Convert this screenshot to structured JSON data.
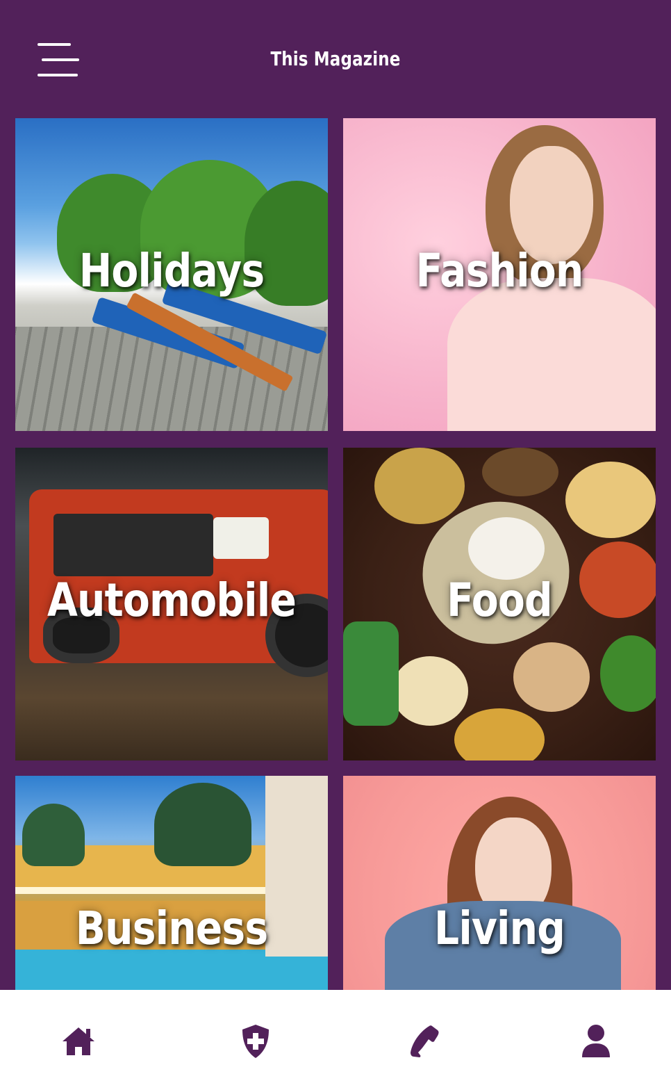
{
  "header": {
    "title": "This Magazine",
    "menu_icon": "hamburger-menu-icon"
  },
  "categories": [
    {
      "label": "Holidays",
      "image": "beach-lounge-chairs"
    },
    {
      "label": "Fashion",
      "image": "woman-pink-background"
    },
    {
      "label": "Automobile",
      "image": "red-ford-truck"
    },
    {
      "label": "Food",
      "image": "table-of-dishes"
    },
    {
      "label": "Business",
      "image": "resort-hotel-pool"
    },
    {
      "label": "Living",
      "image": "woman-denim-jacket"
    }
  ],
  "bottom_nav": {
    "items": [
      {
        "icon": "home-icon"
      },
      {
        "icon": "shield-plus-icon"
      },
      {
        "icon": "phone-icon"
      },
      {
        "icon": "user-icon"
      }
    ]
  },
  "colors": {
    "background": "#52215a",
    "accent": "#52215a",
    "nav_background": "#ffffff",
    "text_on_dark": "#ffffff"
  }
}
